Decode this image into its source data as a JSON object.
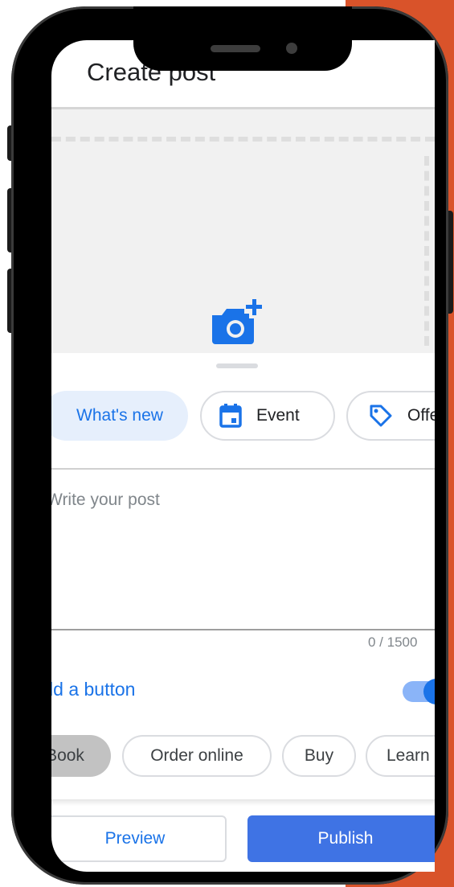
{
  "header": {
    "title": "Create post"
  },
  "media": {
    "add_photo_icon": "add-photo-camera-icon"
  },
  "post_types": [
    {
      "label": "What's new",
      "selected": true
    },
    {
      "label": "Event",
      "icon": "calendar-icon"
    },
    {
      "label": "Offer",
      "icon": "tag-icon"
    }
  ],
  "composer": {
    "placeholder": "Write your post",
    "counter": "0 / 1500"
  },
  "button_section": {
    "label": "Add a button",
    "toggle_on": true
  },
  "action_types": [
    "Book",
    "Order online",
    "Buy",
    "Learn more"
  ],
  "footer": {
    "preview_label": "Preview",
    "publish_label": "Publish"
  },
  "colors": {
    "accent": "#1a73e8",
    "publish_bg": "#3f73e4",
    "chip_selected_bg": "#e6effc",
    "background_panel": "#d9532a"
  }
}
